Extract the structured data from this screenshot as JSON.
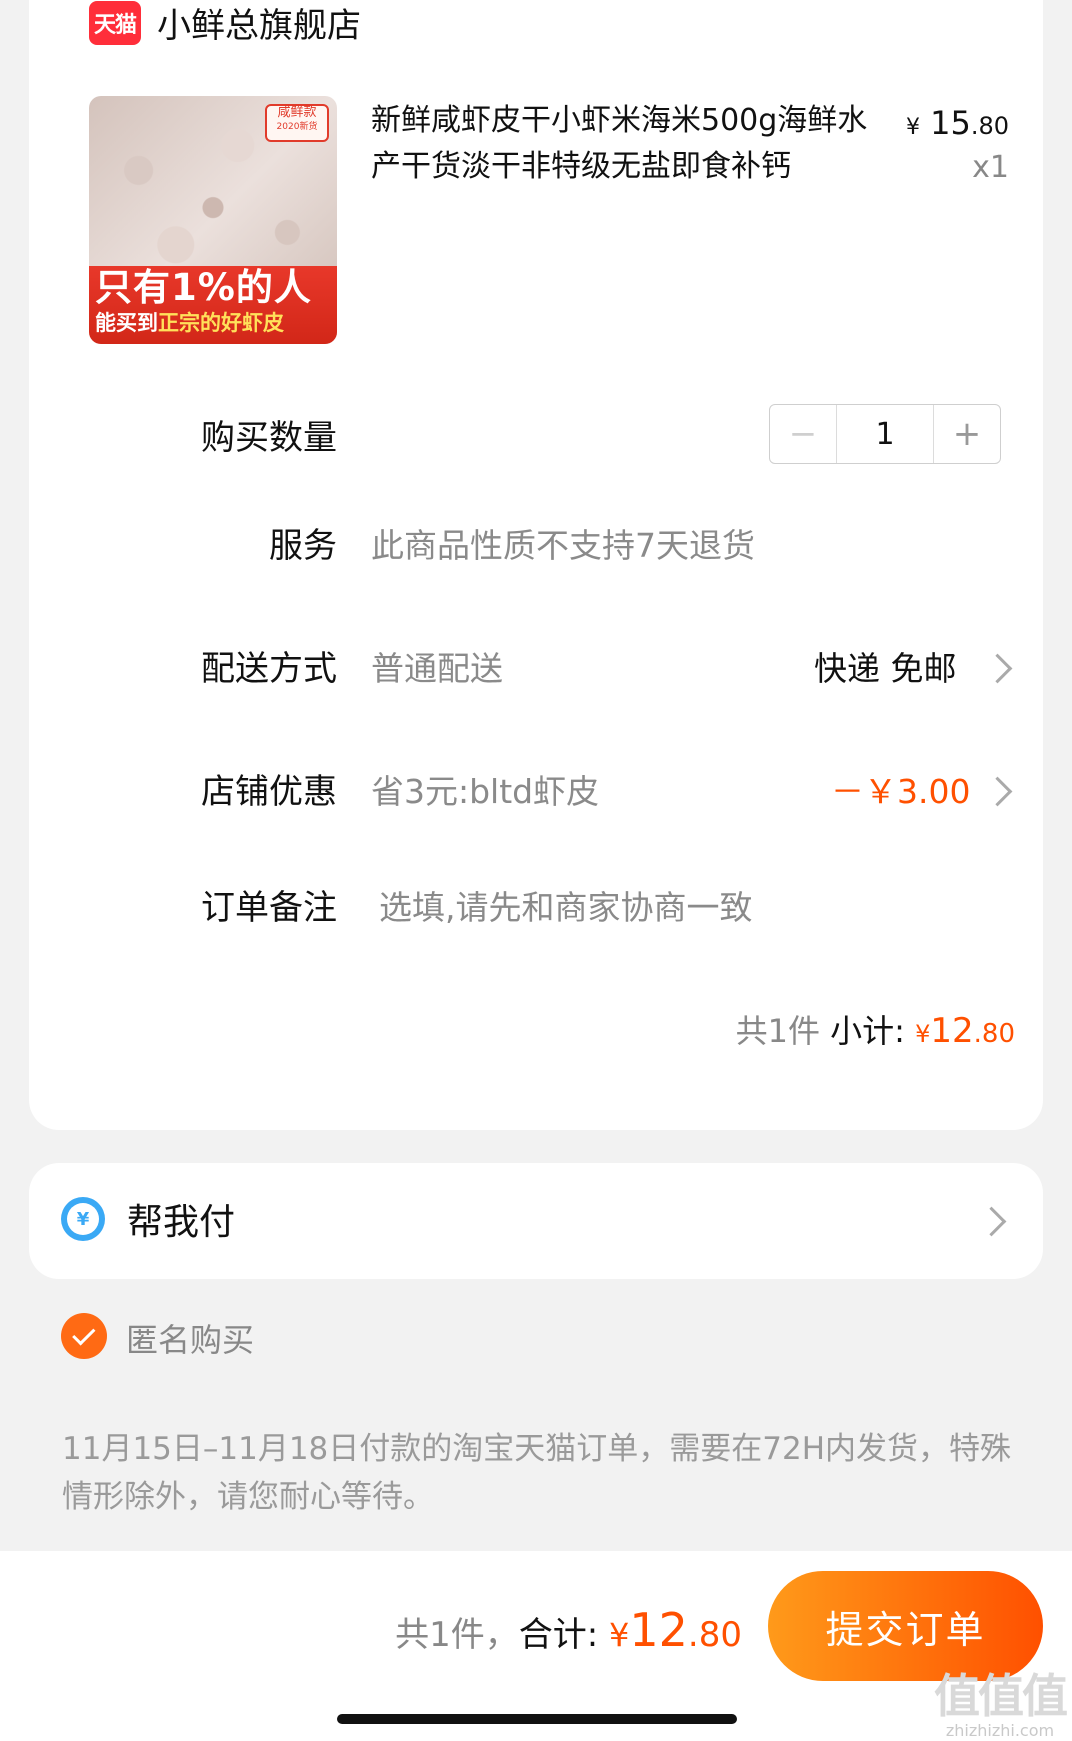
{
  "store": {
    "logo_text": "天猫",
    "name": "小鲜总旗舰店"
  },
  "product": {
    "image_badge_line1": "咸鲜款",
    "image_badge_line2": "2020新货",
    "image_banner_line1": "只有1%的人",
    "image_banner_line2_a": "能买到",
    "image_banner_line2_b": "正宗的好虾皮",
    "title": "新鲜咸虾皮干小虾米海米500g海鲜水产干货淡干非特级无盐即食补钙",
    "price_currency": "¥",
    "price_int": "15",
    "price_dec": ".80",
    "qty_label": "x1"
  },
  "quantity": {
    "label": "购买数量",
    "minus": "−",
    "value": "1",
    "plus": "+"
  },
  "service": {
    "label": "服务",
    "value": "此商品性质不支持7天退货"
  },
  "delivery": {
    "label": "配送方式",
    "value": "普通配送",
    "right": "快递 免邮"
  },
  "discount": {
    "label": "店铺优惠",
    "value": "省3元:bltd虾皮",
    "amount": "－￥3.00"
  },
  "note": {
    "label": "订单备注",
    "placeholder": "选填,请先和商家协商一致"
  },
  "subtotal": {
    "count_text": "共1件",
    "label": "小计:",
    "currency": "¥",
    "int": "12",
    "dec": ".80"
  },
  "help_pay": {
    "icon_text": "¥",
    "label": "帮我付"
  },
  "anonymous": {
    "label": "匿名购买",
    "checked": true
  },
  "notice": "11月15日–11月18日付款的淘宝天猫订单，需要在72H内发货，特殊情形除外，请您耐心等待。",
  "footer": {
    "count_text": "共1件，",
    "total_label": "合计:",
    "currency": "¥",
    "int": "12",
    "dec": ".80",
    "submit_label": "提交订单"
  },
  "watermark": {
    "line1": "值值值",
    "line2": "zhizhizhi.com"
  },
  "colors": {
    "accent": "#ff5000",
    "tmall_red": "#ff2e3a",
    "background": "#f2f2f2"
  }
}
